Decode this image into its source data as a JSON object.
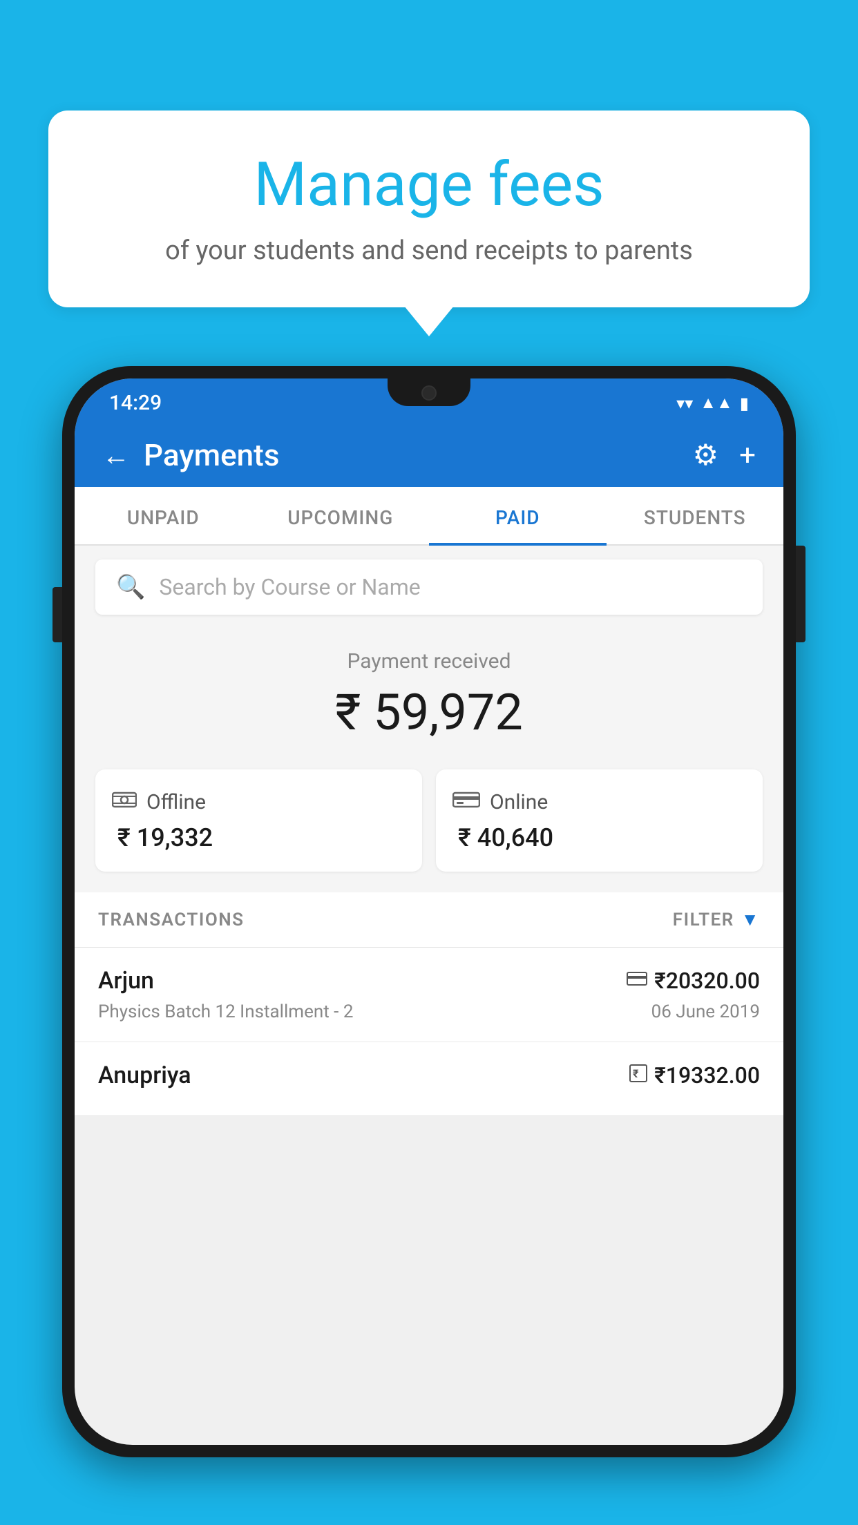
{
  "background_color": "#1ab4e8",
  "bubble": {
    "title": "Manage fees",
    "subtitle": "of your students and send receipts to parents"
  },
  "status_bar": {
    "time": "14:29",
    "wifi_icon": "wifi",
    "signal_icon": "signal",
    "battery_icon": "battery"
  },
  "header": {
    "title": "Payments",
    "back_label": "←",
    "gear_label": "⚙",
    "plus_label": "+"
  },
  "tabs": [
    {
      "id": "unpaid",
      "label": "UNPAID",
      "active": false
    },
    {
      "id": "upcoming",
      "label": "UPCOMING",
      "active": false
    },
    {
      "id": "paid",
      "label": "PAID",
      "active": true
    },
    {
      "id": "students",
      "label": "STUDENTS",
      "active": false
    }
  ],
  "search": {
    "placeholder": "Search by Course or Name",
    "icon": "🔍"
  },
  "payment_summary": {
    "label": "Payment received",
    "total": "₹ 59,972",
    "offline_label": "Offline",
    "offline_amount": "₹ 19,332",
    "online_label": "Online",
    "online_amount": "₹ 40,640"
  },
  "transactions": {
    "header_label": "TRANSACTIONS",
    "filter_label": "FILTER",
    "rows": [
      {
        "name": "Arjun",
        "course": "Physics Batch 12 Installment - 2",
        "amount": "₹20320.00",
        "date": "06 June 2019",
        "payment_type": "card"
      },
      {
        "name": "Anupriya",
        "course": "",
        "amount": "₹19332.00",
        "date": "",
        "payment_type": "offline"
      }
    ]
  }
}
